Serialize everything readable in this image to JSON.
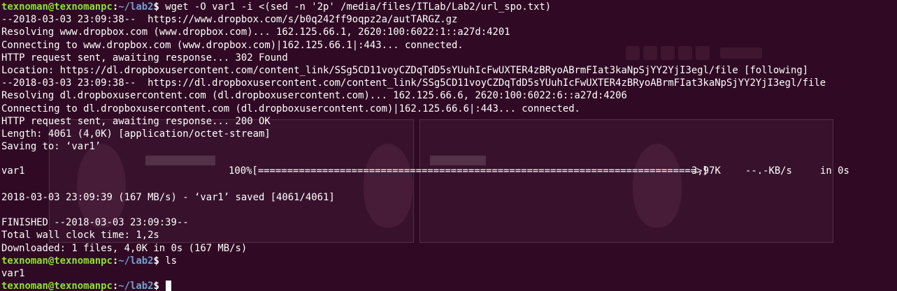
{
  "prompt": {
    "user_host": "texnoman@texnomanpc",
    "colon": ":",
    "path": "~/lab2",
    "dollar": "$"
  },
  "commands": {
    "first": " wget -O var1 -i <(sed -n '2p' /media/files/ITLab/Lab2/url_spo.txt)",
    "second": " ls",
    "third": " "
  },
  "output": {
    "l1": "--2018-03-03 23:09:38--  https://www.dropbox.com/s/b0q242ff9oqpz2a/autTARGZ.gz",
    "l2": "Resolving www.dropbox.com (www.dropbox.com)... 162.125.66.1, 2620:100:6022:1::a27d:4201",
    "l3": "Connecting to www.dropbox.com (www.dropbox.com)|162.125.66.1|:443... connected.",
    "l4": "HTTP request sent, awaiting response... 302 Found",
    "l5": "Location: https://dl.dropboxusercontent.com/content_link/SSg5CD11voyCZDqTdD5sYUuhIcFwUXTER4zBRyoABrmFIat3kaNpSjYY2YjI3egl/file [following]",
    "l6": "--2018-03-03 23:09:38--  https://dl.dropboxusercontent.com/content_link/SSg5CD11voyCZDqTdD5sYUuhIcFwUXTER4zBRyoABrmFIat3kaNpSjYY2YjI3egl/file",
    "l7": "Resolving dl.dropboxusercontent.com (dl.dropboxusercontent.com)... 162.125.66.6, 2620:100:6022:6::a27d:4206",
    "l8": "Connecting to dl.dropboxusercontent.com (dl.dropboxusercontent.com)|162.125.66.6|:443... connected.",
    "l9": "HTTP request sent, awaiting response... 200 OK",
    "l10": "Length: 4061 (4,0K) [application/octet-stream]",
    "l11": "Saving to: ‘var1’",
    "saved": "2018-03-03 23:09:39 (167 MB/s) - ‘var1’ saved [4061/4061]",
    "finished": "FINISHED --2018-03-03 23:09:39--",
    "wall": "Total wall clock time: 1,2s",
    "downloaded": "Downloaded: 1 files, 4,0K in 0s (167 MB/s)",
    "ls_result": "var1"
  },
  "progress": {
    "filename": "var1",
    "bar": "100%[===========================================================================>]",
    "size": "3,97K",
    "speed": "--.-KB/s",
    "eta": "in 0s",
    "percent": 100
  },
  "colors": {
    "background": "#300a24",
    "prompt_user": "#8ae234",
    "prompt_path": "#729fcf",
    "text": "#ffffff"
  }
}
